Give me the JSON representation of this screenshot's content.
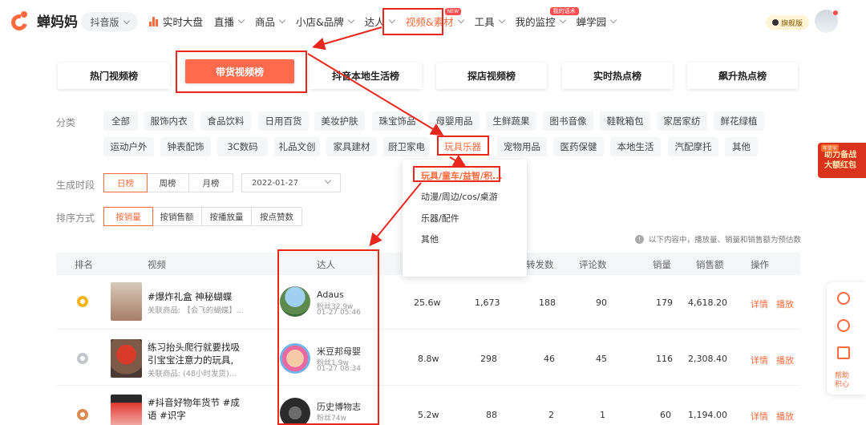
{
  "header": {
    "logo_text": "蝉妈妈",
    "platform": "抖音版",
    "nav": [
      {
        "label": "实时大盘"
      },
      {
        "label": "直播"
      },
      {
        "label": "商品"
      },
      {
        "label": "小店&品牌"
      },
      {
        "label": "达人"
      },
      {
        "label": "视频&素材",
        "badge": "NEW"
      },
      {
        "label": "工具"
      },
      {
        "label": "我的监控",
        "badge": "我的话术"
      },
      {
        "label": "蝉学园"
      }
    ],
    "vip_label": "旗舰版"
  },
  "tabs": [
    "热门视频榜",
    "带货视频榜",
    "抖音本地生活榜",
    "探店视频榜",
    "实时热点榜",
    "飙升热点榜"
  ],
  "filters": {
    "category_label": "分类",
    "categories_row1": [
      "全部",
      "服饰内衣",
      "食品饮料",
      "日用百货",
      "美妆护肤",
      "珠宝饰品",
      "母婴用品",
      "生鲜蔬果",
      "图书音像",
      "鞋靴箱包",
      "家居家纺",
      "鲜花绿植"
    ],
    "categories_row2": [
      "运动户外",
      "钟表配饰",
      "3C数码",
      "礼品文创",
      "家具建材",
      "厨卫家电",
      "玩具乐器",
      "宠物用品",
      "医药保健",
      "本地生活",
      "汽配摩托",
      "其他"
    ],
    "selected_category": "玩具乐器",
    "period_label": "生成时段",
    "periods": [
      "日榜",
      "周榜",
      "月榜"
    ],
    "date": "2022-01-27",
    "sort_label": "排序方式",
    "sorts": [
      "按销量",
      "按销售额",
      "按播放量",
      "按点赞数"
    ],
    "note": "以下内容中，播放量、销量和销售额为预估数"
  },
  "dropdown": {
    "items": [
      "玩具/童车/益智/积...",
      "动漫/周边/cos/桌游",
      "乐器/配件",
      "其他"
    ]
  },
  "table": {
    "headers": [
      "排名",
      "视频",
      "达人",
      "转发数",
      "评论数",
      "销量",
      "销售额",
      "操作"
    ],
    "rows": [
      {
        "title": "#爆炸礼盒 神秘蝴蝶",
        "sub": "关联商品: 【会飞的蝴蝶】...",
        "talent": "Adaus",
        "fans": "粉丝32.9w",
        "time": "01-27 05:46",
        "plays": "25.6w",
        "likes": "1,673",
        "shares": "188",
        "comments": "90",
        "sales": "179",
        "revenue": "4,618.20",
        "detail": "详情",
        "play": "播放"
      },
      {
        "title": "练习抬头爬行就要找吸引宝宝注意力的玩具, 这...",
        "sub": "关联商品: (48小时发货)...",
        "talent": "米豆邦母婴",
        "fans": "粉丝1.9w",
        "time": "01-27 08:34",
        "plays": "8.8w",
        "likes": "298",
        "shares": "46",
        "comments": "45",
        "sales": "116",
        "revenue": "2,308.40",
        "detail": "详情",
        "play": "播放"
      },
      {
        "title": "#抖音好物年货节 #成语 #识字",
        "sub": "",
        "talent": "历史博物志",
        "fans": "粉丝74w",
        "time": "",
        "plays": "5.2w",
        "likes": "88",
        "shares": "2",
        "comments": "1",
        "sales": "60",
        "revenue": "1,194.00",
        "detail": "详情",
        "play": "播放"
      }
    ]
  },
  "side": {
    "banner_tag": "年货节",
    "banner_line1": "助力备战",
    "banner_line2": "大额红包",
    "help_line1": "帮助",
    "help_line2": "积心"
  },
  "colors": {
    "accent": "#ff6a3d",
    "highlight": "#e8281e"
  }
}
